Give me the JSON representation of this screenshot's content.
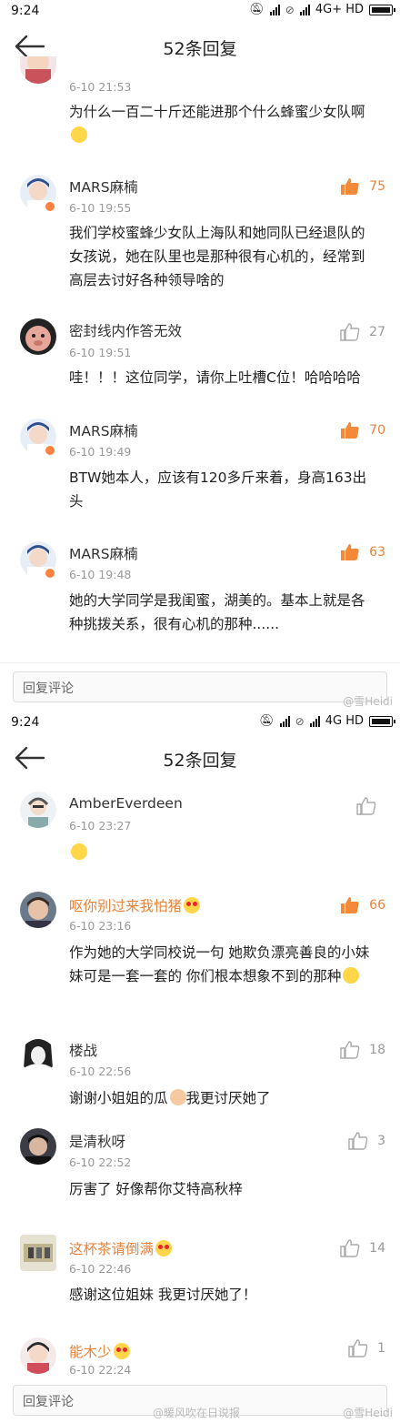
{
  "colors": {
    "accent": "#e8833a",
    "muted": "#999999"
  },
  "screen1": {
    "status": {
      "time": "9:24",
      "network": "4G+ HD",
      "icons": [
        "bell-off-icon",
        "signal-icon",
        "wifi-off-icon",
        "signal-icon",
        "battery-icon"
      ]
    },
    "nav": {
      "title": "52条回复",
      "back_icon": "back-arrow-icon"
    },
    "comments": [
      {
        "name": "",
        "time": "6-10 21:53",
        "text": "为什么一百二十斤还能进那个什么蜂蜜少女队啊",
        "text_emoji": "grin-emoji",
        "likes": null,
        "hot": false
      },
      {
        "name": "MARS麻楠",
        "time": "6-10 19:55",
        "text": "我们学校蜜蜂少女队上海队和她同队已经退队的女孩说，她在队里也是那种很有心机的，经常到高层去讨好各种领导啥的",
        "likes": "75",
        "hot": true
      },
      {
        "name": "密封线内作答无效",
        "time": "6-10 19:51",
        "text": "哇！！！这位同学，请你上吐槽C位！哈哈哈哈",
        "likes": "27",
        "hot": false
      },
      {
        "name": "MARS麻楠",
        "time": "6-10 19:49",
        "text": "BTW她本人，应该有120多斤来着，身高163出头",
        "likes": "70",
        "hot": true
      },
      {
        "name": "MARS麻楠",
        "time": "6-10 19:48",
        "text": "她的大学同学是我闺蜜，湖美的。基本上就是各种挑拨关系，很有心机的那种......",
        "likes": "63",
        "hot": true
      }
    ],
    "reply_placeholder": "回复评论",
    "watermark": "@雪Heidi"
  },
  "screen2": {
    "status": {
      "time": "9:24",
      "network": "4G HD"
    },
    "nav": {
      "title": "52条回复"
    },
    "comments": [
      {
        "name": "AmberEverdeen",
        "time": "6-10 23:27",
        "text": "",
        "text_emoji": "surprised-emoji",
        "likes": "",
        "hot": false
      },
      {
        "name": "呕你别过来我怕猪",
        "time": "6-10 23:16",
        "text": "作为她的大学同校说一句 她欺负漂亮善良的小妹妹可是一套一套的 你们根本想象不到的那种",
        "likes": "66",
        "hot": true
      },
      {
        "name": "楼战",
        "time": "6-10 22:56",
        "text": "谢谢小姐姐的瓜",
        "text_after": "我更讨厌她了",
        "likes": "18",
        "hot": false
      },
      {
        "name": "是清秋呀",
        "time": "6-10 22:52",
        "text": "厉害了 好像帮你艾特高秋梓",
        "likes": "3",
        "hot": false
      },
      {
        "name": "这杯茶请倒满",
        "time": "6-10 22:46",
        "text": "感谢这位姐妹 我更讨厌她了！",
        "likes": "14",
        "hot": false
      },
      {
        "name": "能木少",
        "time": "6-10 22:24",
        "text": "",
        "likes": "1",
        "hot": false
      }
    ],
    "reply_placeholder": "回复评论",
    "watermark1": "@暖风吹在日说报",
    "watermark2": "@雪Heidi"
  }
}
